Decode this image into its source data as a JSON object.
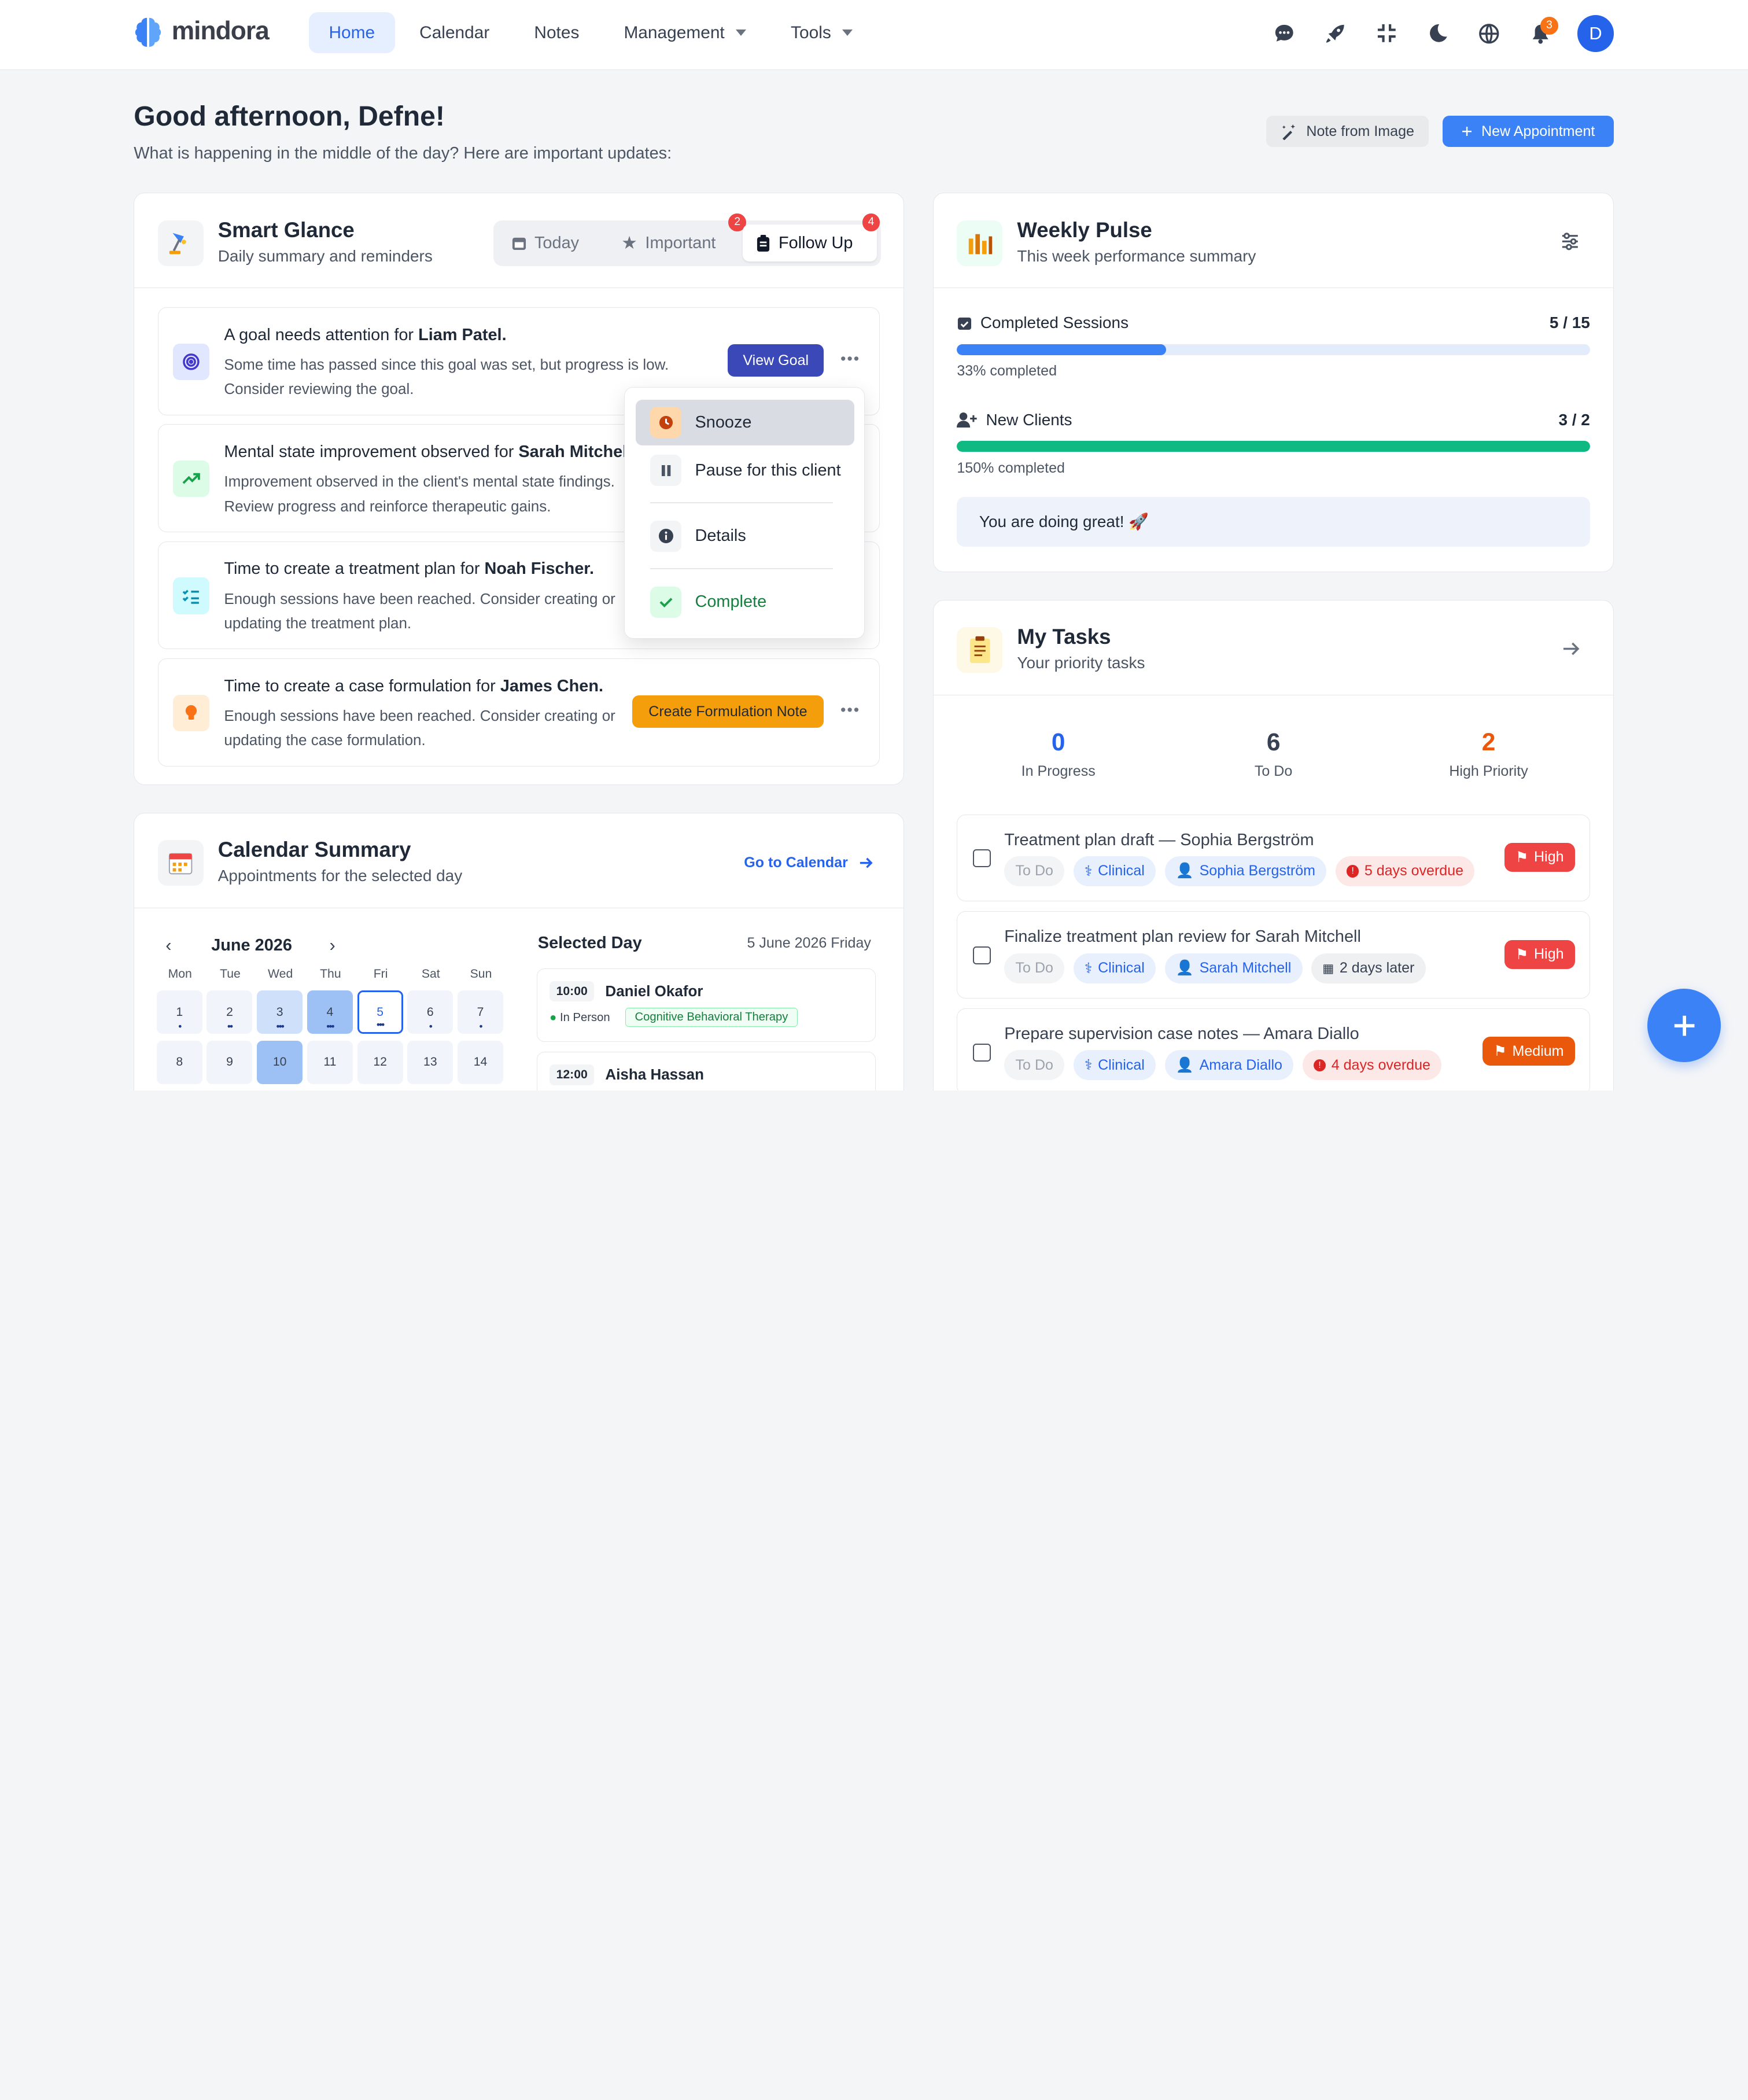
{
  "app": {
    "logo": "mindora"
  },
  "nav": {
    "home": "Home",
    "calendar": "Calendar",
    "notes": "Notes",
    "management": "Management",
    "tools": "Tools"
  },
  "topbar": {
    "notification_count": "3",
    "avatar_initial": "D"
  },
  "page": {
    "greeting": "Good afternoon, Defne!",
    "subtitle": "What is happening in the middle of the day? Here are important updates:",
    "note_from_image": "Note from Image",
    "new_appointment": "New Appointment"
  },
  "smart_glance": {
    "title": "Smart Glance",
    "subtitle": "Daily summary and reminders",
    "tabs": [
      {
        "label": "Today",
        "icon": "calendar-icon"
      },
      {
        "label": "Important",
        "icon": "star-icon",
        "badge": "2"
      },
      {
        "label": "Follow Up",
        "icon": "clipboard-icon",
        "badge": "4"
      }
    ],
    "items": [
      {
        "title_prefix": "A goal needs attention for ",
        "name": "Liam Patel.",
        "desc": "Some time has passed since this goal was set, but progress is low. Consider reviewing the goal.",
        "action": "View Goal",
        "icon": "target-icon"
      },
      {
        "title_prefix": "Mental state improvement observed for ",
        "name": "Sarah Mitchell.",
        "desc": "Improvement observed in the client's mental state findings. Review progress and reinforce therapeutic gains.",
        "icon": "trend-up-icon"
      },
      {
        "title_prefix": "Time to create a treatment plan for ",
        "name": "Noah Fischer.",
        "desc": "Enough sessions have been reached. Consider creating or updating the treatment plan.",
        "icon": "checklist-icon"
      },
      {
        "title_prefix": "Time to create a case formulation for ",
        "name": "James Chen.",
        "desc": "Enough sessions have been reached. Consider creating or updating the case formulation.",
        "action": "Create Formulation Note",
        "icon": "lightbulb-icon"
      }
    ],
    "menu": {
      "snooze": "Snooze",
      "pause": "Pause for this client",
      "details": "Details",
      "complete": "Complete"
    }
  },
  "weekly_pulse": {
    "title": "Weekly Pulse",
    "subtitle": "This week performance summary",
    "completed_sessions": {
      "label": "Completed Sessions",
      "value": "5 / 15",
      "percent_text": "33% completed",
      "fraction": 0.33
    },
    "new_clients": {
      "label": "New Clients",
      "value": "3 / 2",
      "percent_text": "150% completed",
      "fraction": 1.0
    },
    "message": "You are doing great! 🚀"
  },
  "my_tasks": {
    "title": "My Tasks",
    "subtitle": "Your priority tasks",
    "stats": [
      {
        "value": "0",
        "label": "In Progress",
        "color": "#2563eb"
      },
      {
        "value": "6",
        "label": "To Do",
        "color": "#374151"
      },
      {
        "value": "2",
        "label": "High Priority",
        "color": "#ea580c"
      }
    ],
    "tasks": [
      {
        "title": "Treatment plan draft — Sophia Bergström",
        "status": "To Do",
        "category": "Clinical",
        "client": "Sophia Bergström",
        "due": "5 days overdue",
        "priority": "High"
      },
      {
        "title": "Finalize treatment plan review for Sarah Mitchell",
        "status": "To Do",
        "category": "Clinical",
        "client": "Sarah Mitchell",
        "due": "2 days later",
        "priority": "High"
      },
      {
        "title": "Prepare supervision case notes — Amara Diallo",
        "status": "To Do",
        "category": "Clinical",
        "client": "Amara Diallo",
        "due": "4 days overdue",
        "priority": "Medium"
      }
    ]
  },
  "calendar_summary": {
    "title": "Calendar Summary",
    "subtitle": "Appointments for the selected day",
    "go_to": "Go to Calendar",
    "month": "June 2026",
    "weekdays": [
      "Mon",
      "Tue",
      "Wed",
      "Thu",
      "Fri",
      "Sat",
      "Sun"
    ],
    "week1": [
      "1",
      "2",
      "3",
      "4",
      "5",
      "6",
      "7"
    ],
    "week2": [
      "8",
      "9",
      "10",
      "11",
      "12",
      "13",
      "14"
    ],
    "selected_day_label": "Selected Day",
    "selected_date": "5 June 2026 Friday",
    "appointments": [
      {
        "time": "10:00",
        "name": "Daniel Okafor",
        "mode": "In Person",
        "type": "Cognitive Behavioral Therapy"
      },
      {
        "time": "12:00",
        "name": "Aisha Hassan"
      }
    ]
  }
}
